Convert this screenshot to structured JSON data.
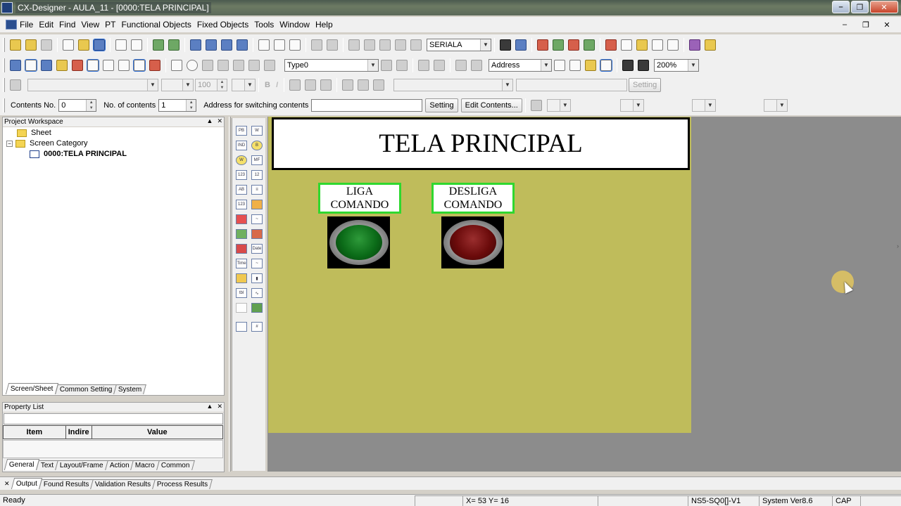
{
  "window": {
    "title": "CX-Designer - AULA_11 - [0000:TELA PRINCIPAL]"
  },
  "menu": [
    "File",
    "Edit",
    "Find",
    "View",
    "PT",
    "Functional Objects",
    "Fixed Objects",
    "Tools",
    "Window",
    "Help"
  ],
  "toolbar": {
    "port_combo": "SERIALA",
    "type_combo": "Type0",
    "address_combo": "Address",
    "zoom_combo": "200%",
    "font_size": "100",
    "setting_disabled_label": "Setting"
  },
  "contents_bar": {
    "contents_no_label": "Contents No.",
    "contents_no_value": "0",
    "no_of_contents_label": "No. of contents",
    "no_of_contents_value": "1",
    "address_label": "Address for switching contents",
    "setting_button": "Setting",
    "edit_contents_button": "Edit Contents..."
  },
  "project_workspace": {
    "title": "Project Workspace",
    "items": [
      "Sheet",
      "Screen Category",
      "0000:TELA PRINCIPAL"
    ],
    "tabs": [
      "Screen/Sheet",
      "Common Setting",
      "System"
    ]
  },
  "property_list": {
    "title": "Property List",
    "columns": [
      "Item",
      "Indire",
      "Value"
    ],
    "tabs": [
      "General",
      "Text",
      "Layout/Frame",
      "Action",
      "Macro",
      "Common"
    ]
  },
  "screen": {
    "title": "TELA PRINCIPAL",
    "buttons": [
      {
        "label": "LIGA\nCOMANDO",
        "lamp_color": "#0b6b18"
      },
      {
        "label": "DESLIGA\nCOMANDO",
        "lamp_color": "#6b0b0b"
      }
    ],
    "background_color": "#bfbc5b"
  },
  "output_tabs": [
    "Output",
    "Found Results",
    "Validation Results",
    "Process Results"
  ],
  "status": {
    "ready": "Ready",
    "coords": "X=  53 Y=  16",
    "pt_model": "NS5-SQ0[]-V1",
    "system_ver": "System Ver8.6",
    "caps": "CAP"
  }
}
